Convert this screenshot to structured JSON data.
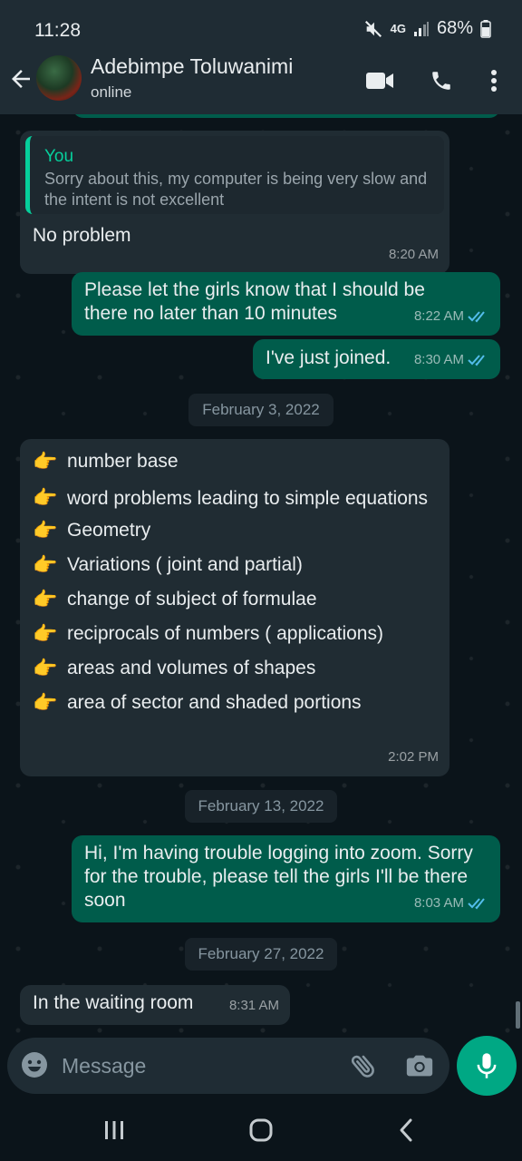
{
  "status_bar": {
    "time": "11:28",
    "network": "4G",
    "battery": "68%"
  },
  "header": {
    "contact_name": "Adebimpe Toluwanimi",
    "contact_status": "online"
  },
  "messages": [
    {
      "quote_author": "You",
      "quote_text": "Sorry about this, my computer is being very slow and the intent is not excellent",
      "text": "No problem",
      "time": "8:20 AM"
    },
    {
      "text": "Please let the girls know that I should be there no later than 10 minutes",
      "time": "8:22 AM"
    },
    {
      "text": "I've just joined.",
      "time": "8:30 AM"
    },
    {
      "date": "February 3, 2022"
    },
    {
      "pointer": "👉",
      "items": [
        "number base",
        "word problems leading to simple equations",
        "Geometry",
        "Variations ( joint and partial)",
        "change of subject of formulae",
        "reciprocals of numbers ( applications)",
        "areas and volumes of shapes",
        "area of sector and shaded portions"
      ],
      "time": "2:02 PM"
    },
    {
      "date": "February 13, 2022"
    },
    {
      "text": "Hi, I'm having trouble logging into zoom. Sorry for the trouble, please tell the girls I'll be there soon",
      "time": "8:03 AM"
    },
    {
      "date": "February 27, 2022"
    },
    {
      "text": "In the waiting room",
      "time": "8:31 AM"
    }
  ],
  "composer": {
    "placeholder": "Message"
  },
  "colors": {
    "app_bar": "#1f2c34",
    "chat_bg": "#0b141a",
    "incoming": "#202c33",
    "outgoing": "#005c4b",
    "accent": "#00a884",
    "read_tick": "#53bdeb"
  },
  "icons": {
    "back": "arrow-left-icon",
    "video": "video-call-icon",
    "call": "phone-icon",
    "menu": "more-vert-icon",
    "emoji": "emoji-icon",
    "attach": "paperclip-icon",
    "camera": "camera-icon",
    "mic": "mic-icon"
  }
}
